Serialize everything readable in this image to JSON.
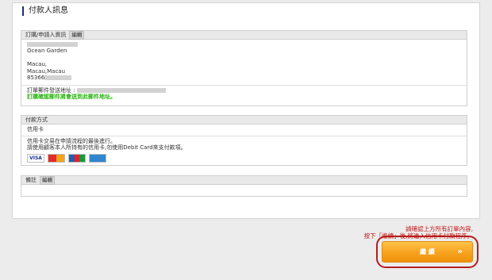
{
  "title": "付款人訊息",
  "buyer": {
    "header": "訂購/申請人資訊",
    "edit_label": "編輯",
    "address_line1": "Ocean Garden",
    "address_line2": "Macau,",
    "address_line3": "Macau,Macau",
    "phone_prefix": "85366",
    "email_label": "訂單郵件發送地址 :",
    "email_note": "訂購確認郵件將會送到此郵件地址。"
  },
  "payment": {
    "header": "付款方式",
    "method": "信用卡",
    "desc1": "信用卡交易在申請流程的最後進行。",
    "desc2": "請使用顧客本人所持有的信用卡,勿使用Debit Card來支付款項。",
    "cards": [
      "VISA",
      "MC",
      "JCB",
      "AMEX"
    ]
  },
  "remarks": {
    "header": "備註",
    "edit_label": "編輯"
  },
  "footer": {
    "note1": "請確認上方所有訂單內容,",
    "note2": "按下「繼續」後,將進入信用卡付款程序。",
    "next_label": "繼 續",
    "next_arrow": "»"
  },
  "colors": {
    "accent": "#f7a21d",
    "note_red": "#c01818",
    "note_green": "#27b310",
    "title_bar": "#1a2f6e"
  }
}
